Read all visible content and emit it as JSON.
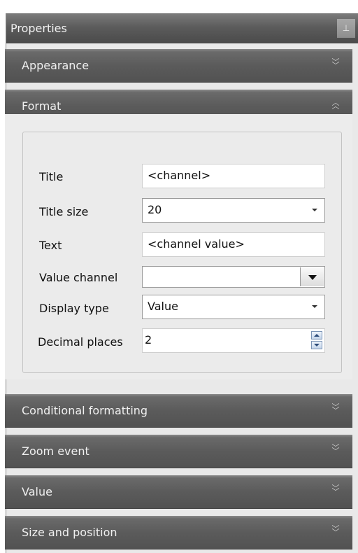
{
  "panel": {
    "title": "Properties",
    "pin_icon": "⊥"
  },
  "sections": {
    "appearance": "Appearance",
    "format": "Format",
    "conditional_formatting": "Conditional formatting",
    "zoom_event": "Zoom event",
    "value": "Value",
    "size_and_position": "Size and position"
  },
  "chevrons": {
    "down": "∨",
    "up": "∧"
  },
  "format_fields": {
    "title_label": "Title",
    "title_value": "<channel>",
    "title_size_label": "Title size",
    "title_size_value": "20",
    "text_label": "Text",
    "text_value": "<channel value>",
    "value_channel_label": "Value channel",
    "value_channel_value": "",
    "display_type_label": "Display type",
    "display_type_value": "Value",
    "decimal_places_label": "Decimal places",
    "decimal_places_value": "2"
  }
}
